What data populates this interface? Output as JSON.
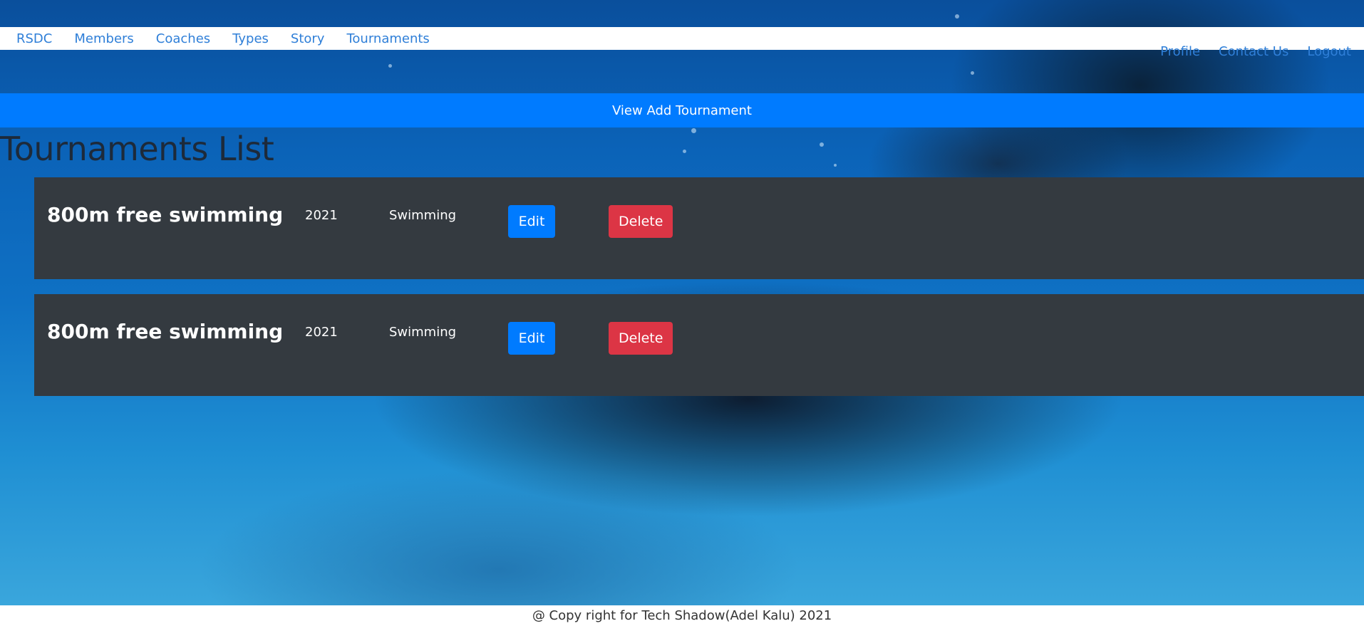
{
  "nav": {
    "left": [
      "RSDC",
      "Members",
      "Coaches",
      "Types",
      "Story",
      "Tournaments"
    ],
    "right": [
      "Profile",
      "Contact Us",
      "Logout"
    ]
  },
  "banner": {
    "label": "View Add Tournament"
  },
  "page": {
    "title": "Tournaments List"
  },
  "tournaments": [
    {
      "name": "800m free swimming",
      "year": "2021",
      "type": "Swimming",
      "edit_label": "Edit",
      "delete_label": "Delete"
    },
    {
      "name": "800m free swimming",
      "year": "2021",
      "type": "Swimming",
      "edit_label": "Edit",
      "delete_label": "Delete"
    }
  ],
  "footer": {
    "text": "@ Copy right for Tech Shadow(Adel Kalu) 2021"
  },
  "colors": {
    "primary": "#007bff",
    "danger": "#dc3545",
    "card": "#343a40",
    "link": "#2f7fd8"
  }
}
